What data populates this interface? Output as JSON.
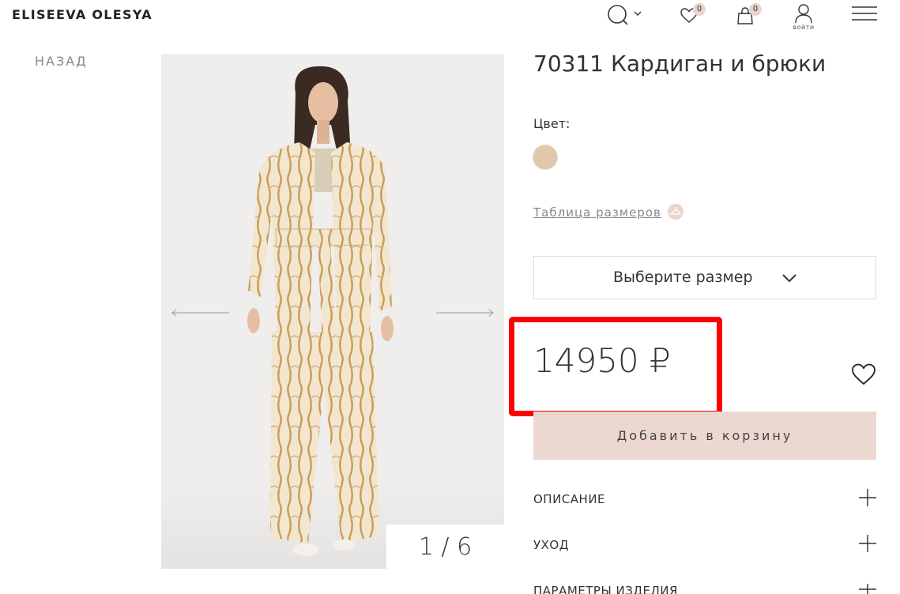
{
  "header": {
    "logo": "ELISEEVA OLESYA",
    "favorites_count": "0",
    "cart_count": "0",
    "login_label": "войти"
  },
  "nav": {
    "back_label": "НАЗАД"
  },
  "gallery": {
    "counter": "1 / 6"
  },
  "product": {
    "title": "70311 Кардиган и брюки",
    "color_label": "Цвет:",
    "color_swatch": "#dfc9aa",
    "size_chart_label": "Таблица размеров",
    "size_select_placeholder": "Выберите размер",
    "price": "14950 ₽",
    "add_to_cart_label": "Добавить в корзину"
  },
  "accordion": [
    {
      "label": "ОПИСАНИЕ"
    },
    {
      "label": "УХОД"
    },
    {
      "label": "ПАРАМЕТРЫ ИЗДЕЛИЯ"
    }
  ],
  "colors": {
    "accent_button": "#ecd8d0",
    "highlight": "#ff0000"
  }
}
